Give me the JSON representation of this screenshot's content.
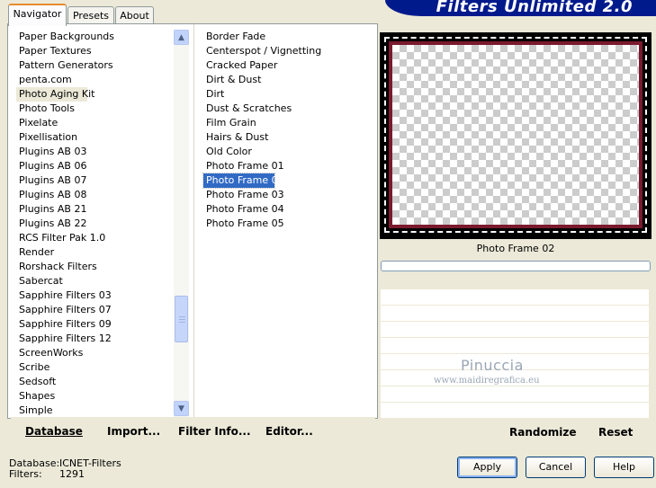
{
  "tabs": [
    {
      "label": "Navigator",
      "active": true
    },
    {
      "label": "Presets",
      "active": false
    },
    {
      "label": "About",
      "active": false
    }
  ],
  "banner_title": "Filters Unlimited 2.0",
  "categories": [
    "Paper Backgrounds",
    "Paper Textures",
    "Pattern Generators",
    "penta.com",
    "Photo Aging Kit",
    "Photo Tools",
    "Pixelate",
    "Pixellisation",
    "Plugins AB 03",
    "Plugins AB 06",
    "Plugins AB 07",
    "Plugins AB 08",
    "Plugins AB 21",
    "Plugins AB 22",
    "RCS Filter Pak 1.0",
    "Render",
    "Rorshack Filters",
    "Sabercat",
    "Sapphire Filters 03",
    "Sapphire Filters 07",
    "Sapphire Filters 09",
    "Sapphire Filters 12",
    "ScreenWorks",
    "Scribe",
    "Sedsoft",
    "Shapes",
    "Simple"
  ],
  "selected_category": "Photo Aging Kit",
  "filters": [
    "Border Fade",
    "Centerspot / Vignetting",
    "Cracked Paper",
    "Dirt & Dust",
    "Dirt",
    "Dust & Scratches",
    "Film Grain",
    "Hairs & Dust",
    "Old Color",
    "Photo Frame 01",
    "Photo Frame 02",
    "Photo Frame 03",
    "Photo Frame 04",
    "Photo Frame 05"
  ],
  "selected_filter": "Photo Frame 02",
  "toolbar": {
    "database": "Database",
    "import": "Import...",
    "filter_info": "Filter Info...",
    "editor": "Editor..."
  },
  "preview": {
    "filter_name": "Photo Frame 02",
    "frame_color": "#7a1a2e"
  },
  "right_toolbar": {
    "randomize": "Randomize",
    "reset": "Reset"
  },
  "watermark": {
    "name": "Pinuccia",
    "url": "www.maidiregrafica.eu"
  },
  "status": {
    "database_label": "Database:",
    "database_value": "ICNET-Filters",
    "filters_label": "Filters:",
    "filters_value": "1291"
  },
  "buttons": {
    "apply": "Apply",
    "cancel": "Cancel",
    "help": "Help"
  },
  "colors": {
    "accent": "#316ac5",
    "banner": "#001a8c",
    "background": "#ece9d8"
  }
}
